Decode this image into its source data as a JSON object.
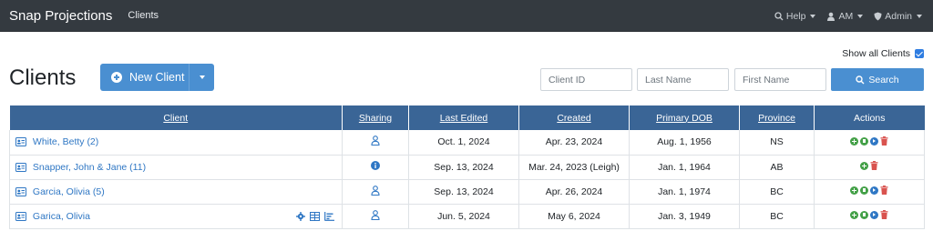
{
  "navbar": {
    "brand": "Snap Projections",
    "link": "Clients",
    "help": "Help",
    "user": "AM",
    "admin": "Admin"
  },
  "show_all": "Show all Clients",
  "page_title": "Clients",
  "new_client": "New Client",
  "search": {
    "client_id_placeholder": "Client ID",
    "last_name_placeholder": "Last Name",
    "first_name_placeholder": "First Name",
    "button": "Search"
  },
  "colors": {
    "navbar": "#343a40",
    "header": "#3a6596",
    "accent": "#4a8fd1",
    "link": "#2f77c4",
    "green": "#43a047",
    "red": "#d9534f"
  },
  "table": {
    "headers": [
      "Client",
      "Sharing",
      "Last Edited",
      "Created",
      "Primary DOB",
      "Province",
      "Actions"
    ],
    "rows": [
      {
        "client": "White, Betty (2)",
        "sharing": "person-icon",
        "last_edited": "Oct. 1, 2024",
        "created": "Apr. 23, 2024",
        "dob": "Aug. 1, 1956",
        "province": "NS"
      },
      {
        "client": "Snapper, John & Jane (11)",
        "sharing": "info-icon",
        "last_edited": "Sep. 13, 2024",
        "created": "Mar. 24, 2023 (Leigh)",
        "dob": "Jan. 1, 1964",
        "province": "AB"
      },
      {
        "client": "Garcia, Olivia (5)",
        "sharing": "person-icon",
        "last_edited": "Sep. 13, 2024",
        "created": "Apr. 26, 2024",
        "dob": "Jan. 1, 1974",
        "province": "BC"
      },
      {
        "client": "Garica, Olivia",
        "sharing": "person-icon",
        "last_edited": "Jun. 5, 2024",
        "created": "May 6, 2024",
        "dob": "Jan. 3, 1949",
        "province": "BC"
      }
    ]
  }
}
